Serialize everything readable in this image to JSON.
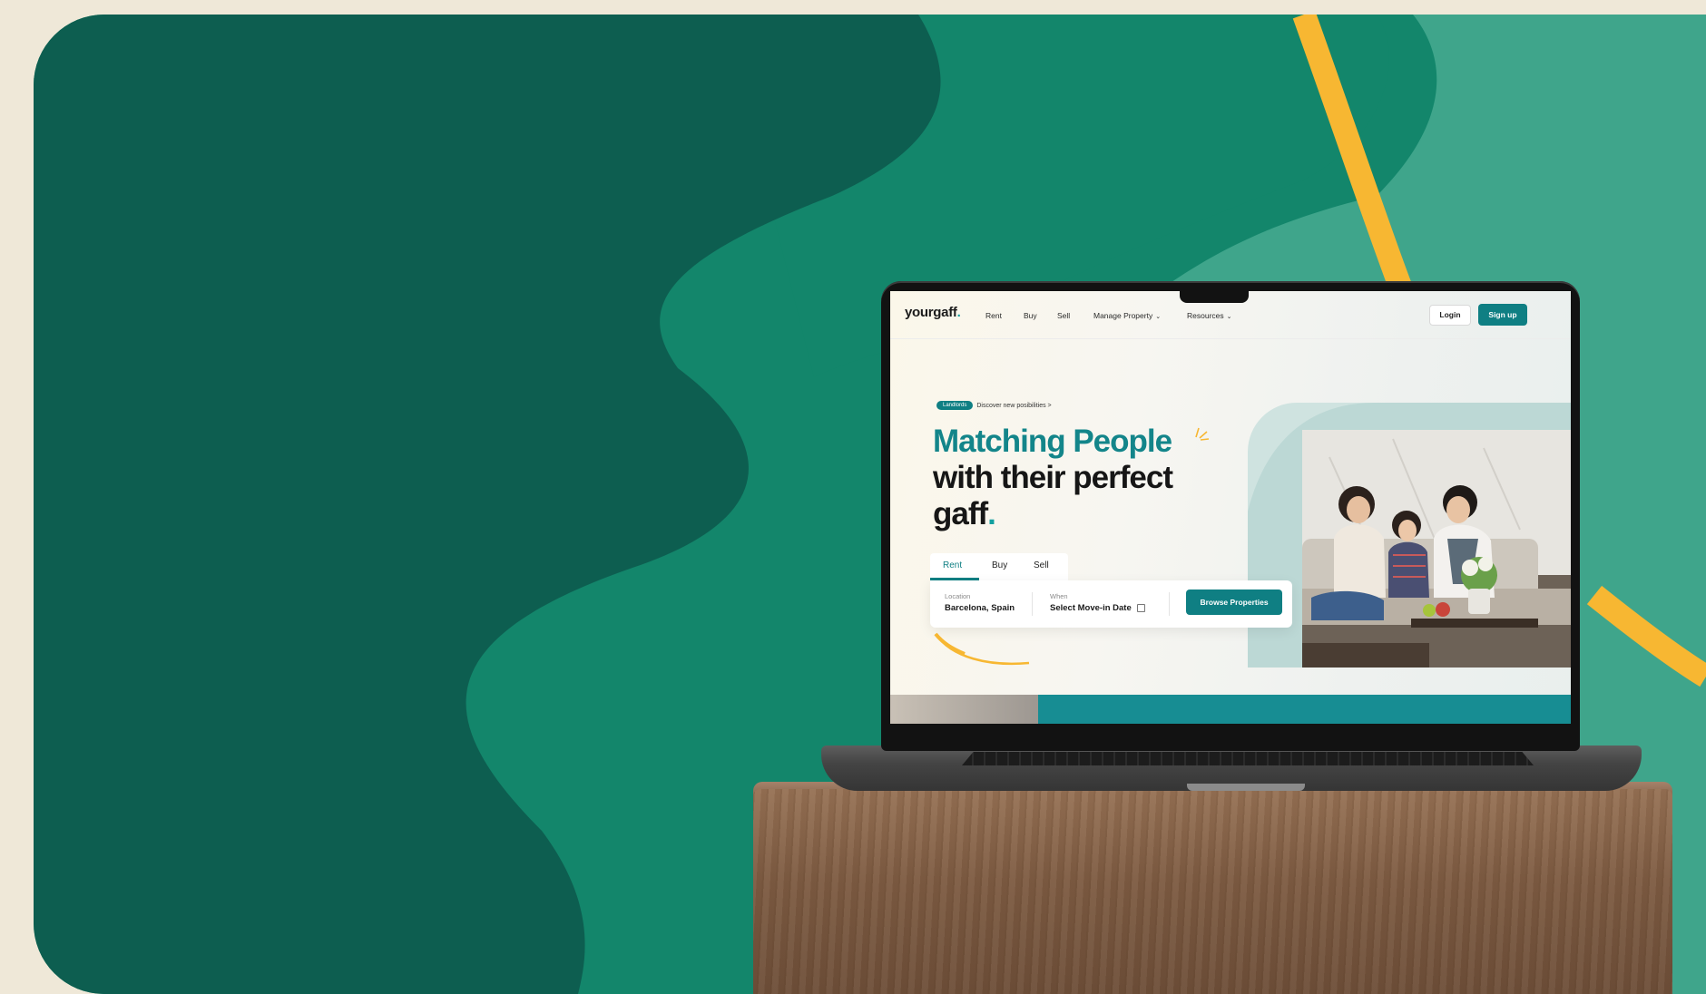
{
  "colors": {
    "page_bg": "#efe8d8",
    "card_dark": "#0d5e50",
    "card_mid": "#13866b",
    "card_light": "#3fa58b",
    "accent_yellow": "#f7b732",
    "brand_teal": "#0f7f83"
  },
  "site": {
    "logo": "yourgaff",
    "logo_dot": ".",
    "nav": {
      "rent": "Rent",
      "buy": "Buy",
      "sell": "Sell",
      "manage_property": "Manage Property",
      "resources": "Resources"
    },
    "login_label": "Login",
    "signup_label": "Sign up"
  },
  "hero": {
    "pill_label": "Landlords",
    "pill_text": "Discover new posibilities >",
    "headline_line1": "Matching People",
    "headline_line2": "with their perfect",
    "headline_line3": "gaff",
    "headline_dot": "."
  },
  "search": {
    "tabs": {
      "rent": "Rent",
      "buy": "Buy",
      "sell": "Sell"
    },
    "location_label": "Location",
    "location_value": "Barcelona, Spain",
    "when_label": "When",
    "when_value": "Select Move-in Date",
    "browse_label": "Browse Properties"
  }
}
